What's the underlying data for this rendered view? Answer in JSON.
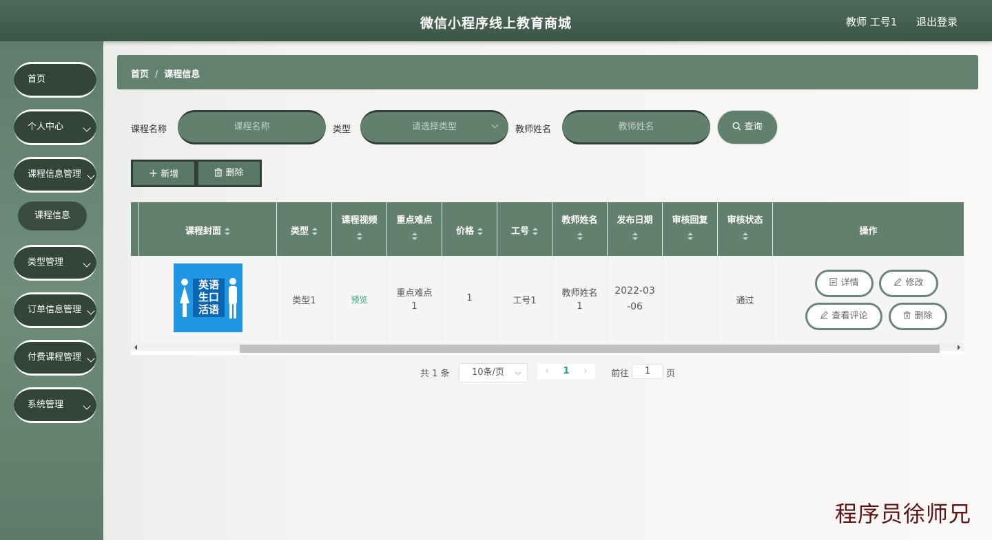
{
  "header": {
    "title": "微信小程序线上教育商城",
    "user": "教师 工号1",
    "logout": "退出登录"
  },
  "sidebar": {
    "items": [
      {
        "label": "首页"
      },
      {
        "label": "个人中心"
      },
      {
        "label": "课程信息管理"
      },
      {
        "label": "类型管理"
      },
      {
        "label": "订单信息管理"
      },
      {
        "label": "付费课程管理"
      },
      {
        "label": "系统管理"
      }
    ],
    "sub_item": "课程信息"
  },
  "breadcrumb": {
    "home": "首页",
    "separator": "/",
    "current": "课程信息"
  },
  "search": {
    "course_name_label": "课程名称",
    "course_name_placeholder": "课程名称",
    "type_label": "类型",
    "type_placeholder": "请选择类型",
    "teacher_label": "教师姓名",
    "teacher_placeholder": "教师姓名",
    "query_button": "查询"
  },
  "toolbar": {
    "add": "新增",
    "delete": "删除"
  },
  "table": {
    "headers": [
      "课程封面",
      "类型",
      "课程视频",
      "重点难点",
      "价格",
      "工号",
      "教师姓名",
      "发布日期",
      "审核回复",
      "审核状态",
      "操作"
    ],
    "row": {
      "cover_text_1": "英语",
      "cover_text_2": "生口",
      "cover_text_3": "活语",
      "type": "类型1",
      "video": "预览",
      "difficulty_1": "重点难点",
      "difficulty_2": "1",
      "price": "1",
      "job_no": "工号1",
      "teacher_1": "教师姓名",
      "teacher_2": "1",
      "date_1": "2022-03",
      "date_2": "-06",
      "reply": "",
      "status": "通过"
    },
    "actions": {
      "detail": "详情",
      "edit": "修改",
      "comments": "查看评论",
      "delete": "删除"
    }
  },
  "pagination": {
    "total": "共 1 条",
    "page_size": "10条/页",
    "current_page": "1",
    "goto_label": "前往",
    "goto_value": "1",
    "page_unit": "页"
  },
  "watermark": "程序员徐师兄",
  "colors": {
    "header": "#3b5546",
    "accent": "#63816f",
    "dark": "#334438"
  }
}
